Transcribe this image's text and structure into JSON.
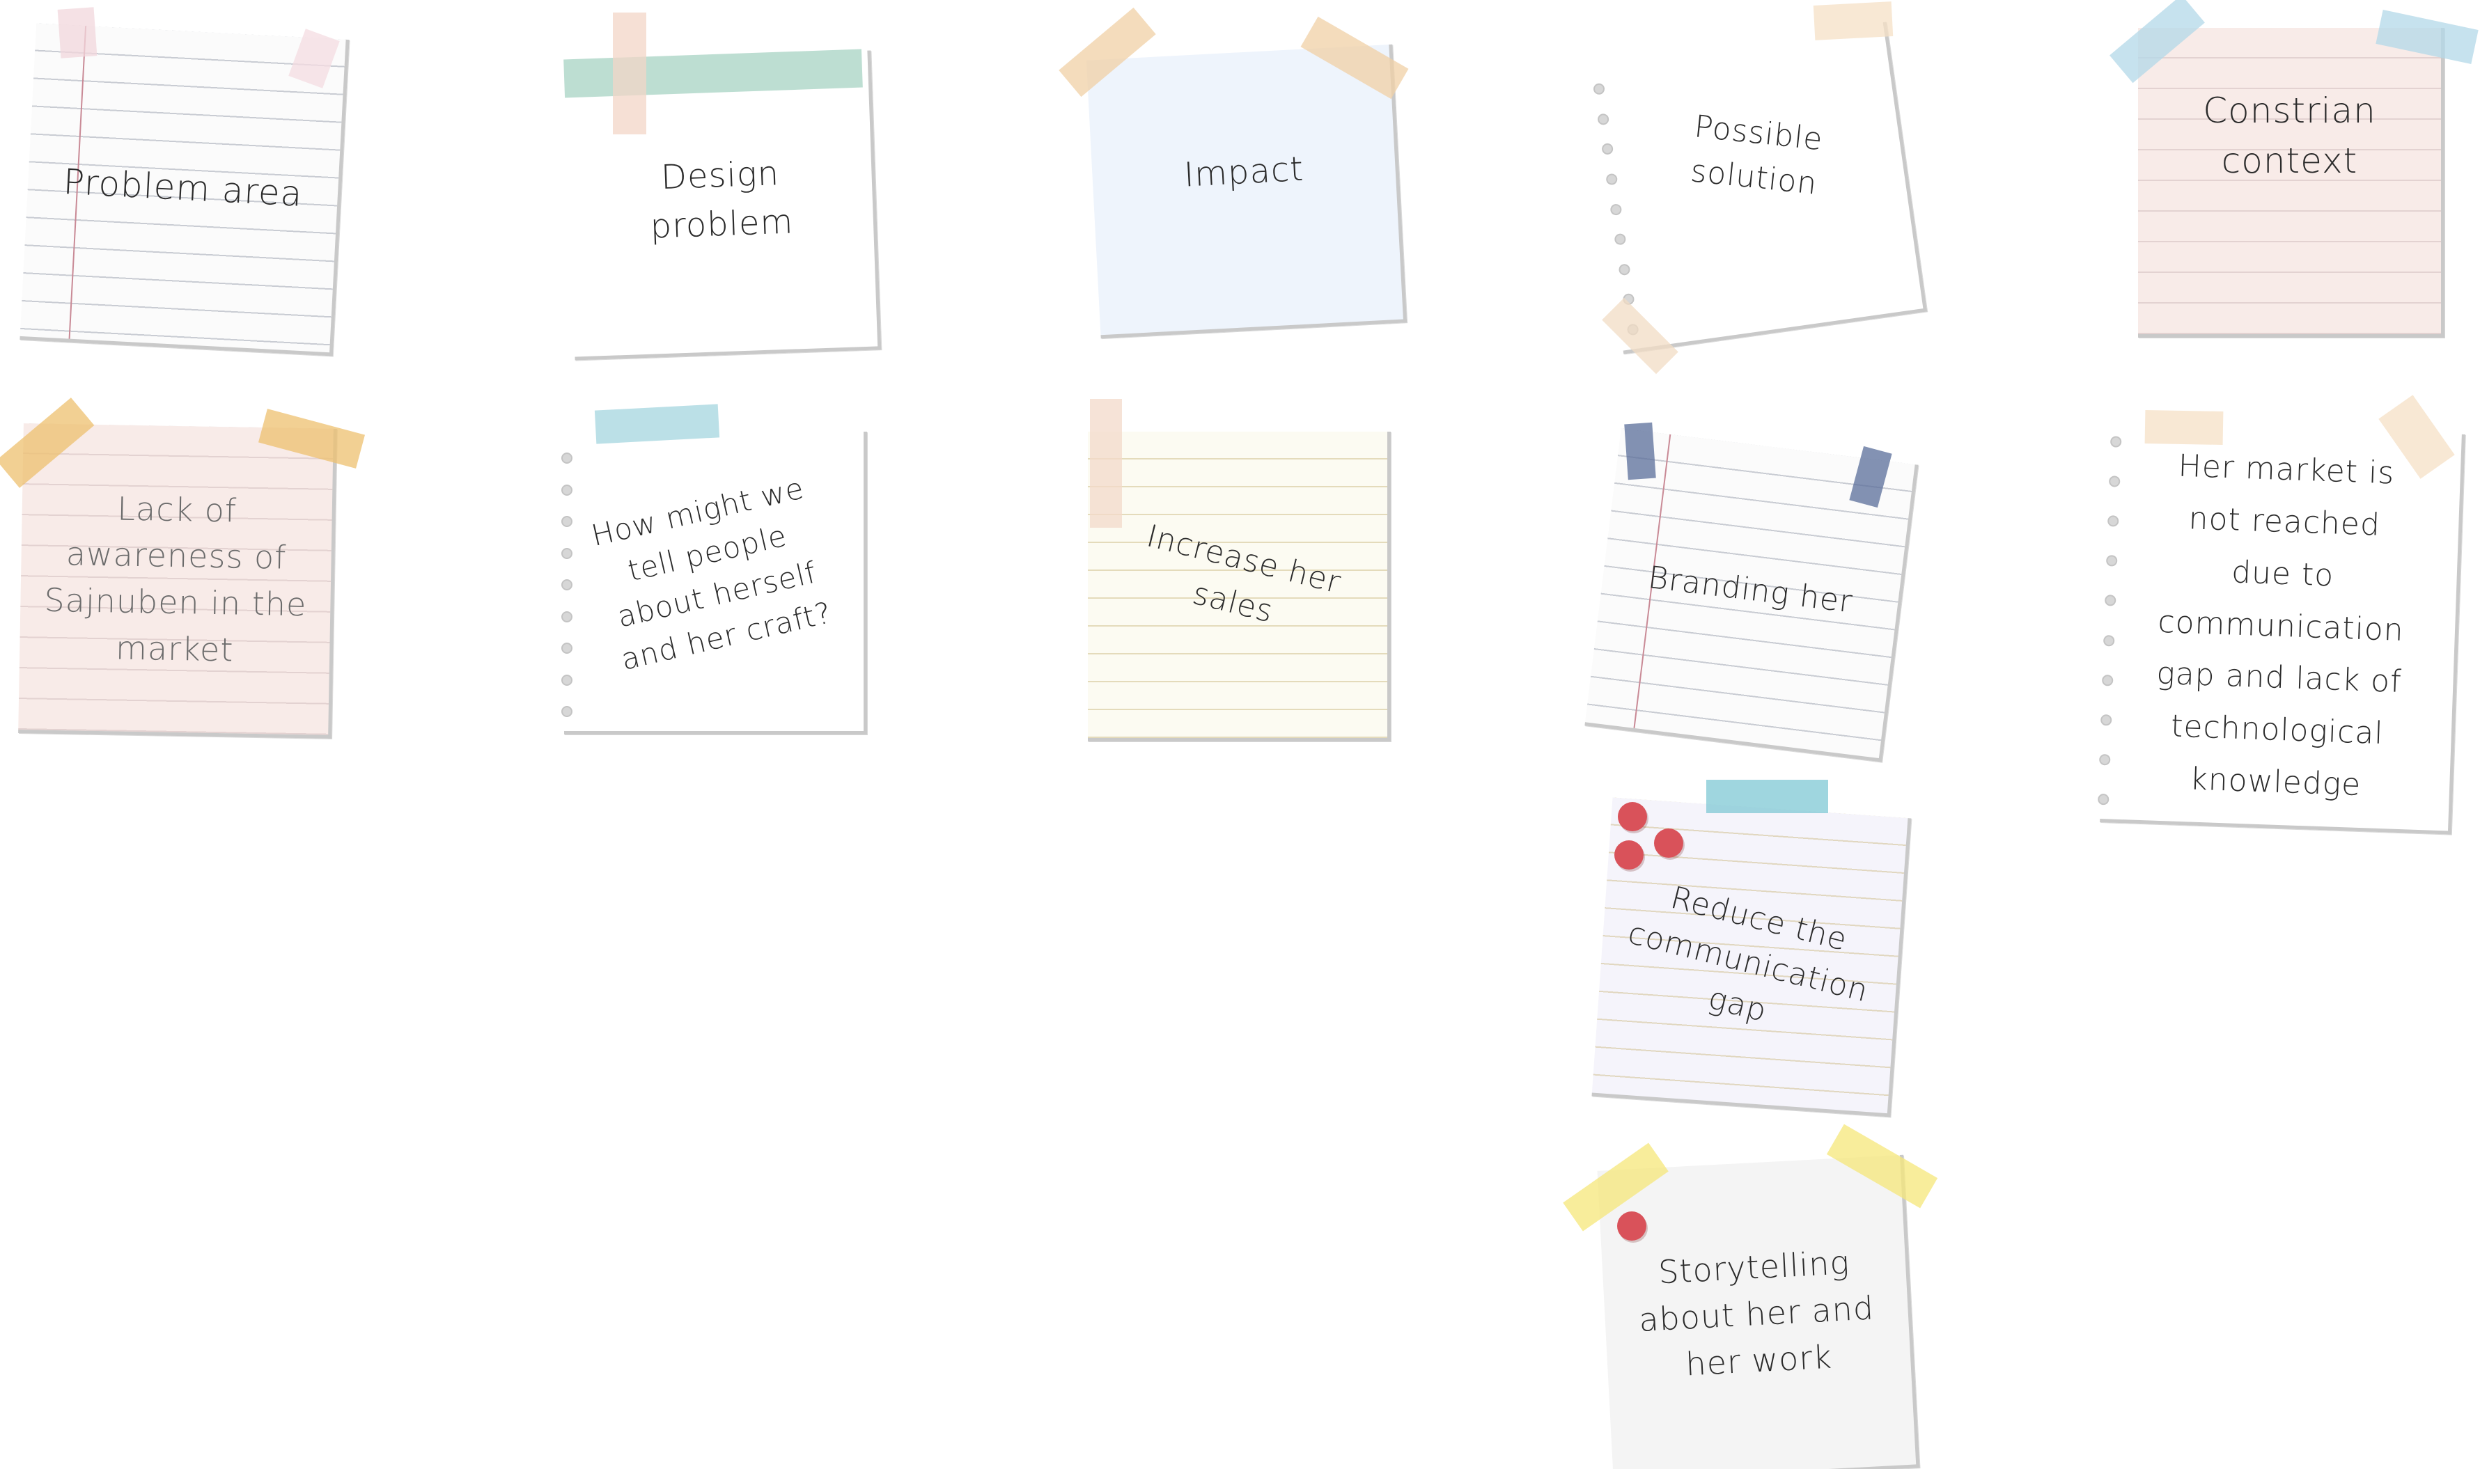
{
  "notes": {
    "problem_area": "Problem area",
    "design_problem": "Design problem",
    "impact": "Impact",
    "possible_solution": "Possible solution",
    "constraint_context": "Constrian context",
    "lack_of_awareness": "Lack of awareness of Sajnuben in the market",
    "how_might_we": "How might we tell people about herself and her craft?",
    "increase_sales": "Increase her sales",
    "branding": "Branding her",
    "market_not_reached": "Her market is not reached due to communication gap and lack of technological knowledge",
    "reduce_gap": "Reduce the communication gap",
    "storytelling": "Storytelling about her and her work"
  },
  "colors": {
    "lined_paper": "#fbfbfb",
    "blue_paper": "#eef4fc",
    "pink_paper": "#f8ebe8",
    "cream_paper": "#fcfbf2",
    "lavender_paper": "#f5f4fb",
    "grey_paper": "#f4f4f4",
    "pin_red": "#d9525a"
  }
}
